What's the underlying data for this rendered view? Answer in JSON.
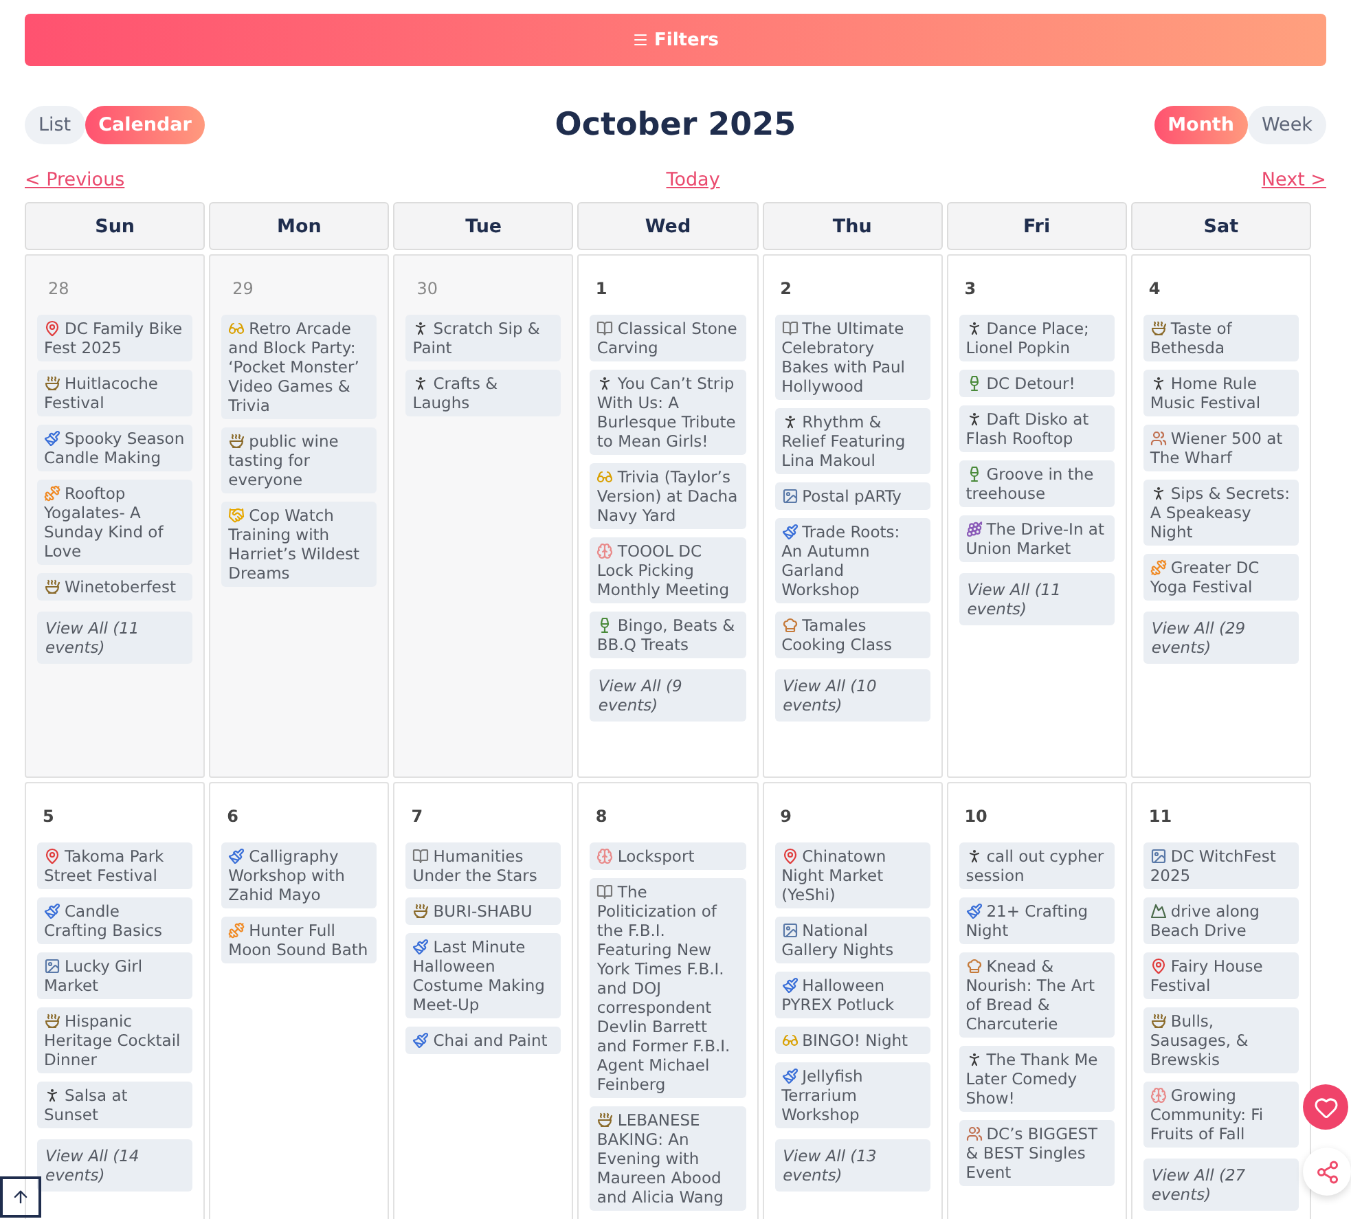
{
  "filters_button": {
    "label": "Filters"
  },
  "view_modes": [
    {
      "label": "List",
      "selected": false
    },
    {
      "label": "Calendar",
      "selected": true
    }
  ],
  "title": "October 2025",
  "range_modes": [
    {
      "label": "Month",
      "selected": true
    },
    {
      "label": "Week",
      "selected": false
    }
  ],
  "nav": {
    "previous": "< Previous",
    "today": "Today",
    "next": "Next >"
  },
  "weekdays": [
    "Sun",
    "Mon",
    "Tue",
    "Wed",
    "Thu",
    "Fri",
    "Sat"
  ],
  "weeks": [
    {
      "days": [
        {
          "number": "28",
          "other_month": true,
          "events": [
            {
              "kind": "pin",
              "title": "DC Family Bike Fest 2025"
            },
            {
              "kind": "bowl",
              "title": "Huitlacoche Festival"
            },
            {
              "kind": "brush",
              "title": "Spooky Season Candle Making"
            },
            {
              "kind": "yoga",
              "title": "Rooftop Yogalates- A Sunday Kind of Love"
            },
            {
              "kind": "bowl",
              "title": "Winetoberfest"
            }
          ],
          "view_all": "View All (11 events)"
        },
        {
          "number": "29",
          "other_month": true,
          "events": [
            {
              "kind": "game",
              "title": "Retro Arcade and Block Party: ‘Pocket Monster’ Video Games & Trivia"
            },
            {
              "kind": "bowl",
              "title": "public wine tasting for everyone"
            },
            {
              "kind": "handshake",
              "title": "Cop Watch Training with Harriet’s Wildest Dreams"
            }
          ]
        },
        {
          "number": "30",
          "other_month": true,
          "events": [
            {
              "kind": "dancer",
              "title": "Scratch Sip & Paint"
            },
            {
              "kind": "dancer",
              "title": "Crafts & Laughs"
            }
          ]
        },
        {
          "number": "1",
          "other_month": false,
          "events": [
            {
              "kind": "book",
              "title": "Classical Stone Carving"
            },
            {
              "kind": "dancer",
              "title": "You Can’t Strip With Us: A Burlesque Tribute to Mean Girls!"
            },
            {
              "kind": "game",
              "title": "Trivia (Taylor’s Version) at Dacha Navy Yard"
            },
            {
              "kind": "brain",
              "title": "TOOOL DC Lock Picking Monthly Meeting"
            },
            {
              "kind": "bottle",
              "title": "Bingo, Beats & BB.Q Treats"
            }
          ],
          "view_all": "View All (9 events)"
        },
        {
          "number": "2",
          "other_month": false,
          "events": [
            {
              "kind": "book",
              "title": "The Ultimate Celebratory Bakes with Paul Hollywood"
            },
            {
              "kind": "dancer",
              "title": "Rhythm & Relief Featuring Lina Makoul"
            },
            {
              "kind": "picture",
              "title": "Postal pARTy"
            },
            {
              "kind": "brush",
              "title": "Trade Roots: An Autumn Garland Workshop"
            },
            {
              "kind": "cook",
              "title": "Tamales Cooking Class"
            }
          ],
          "view_all": "View All (10 events)"
        },
        {
          "number": "3",
          "other_month": false,
          "events": [
            {
              "kind": "dancer",
              "title": "Dance Place; Lionel Popkin"
            },
            {
              "kind": "bottle",
              "title": "DC Detour!"
            },
            {
              "kind": "dancer",
              "title": "Daft Disko at Flash Rooftop"
            },
            {
              "kind": "bottle",
              "title": "Groove in the treehouse"
            },
            {
              "kind": "grapes",
              "title": "The Drive-In at Union Market"
            }
          ],
          "view_all": "View All (11 events)"
        },
        {
          "number": "4",
          "other_month": false,
          "events": [
            {
              "kind": "bowl",
              "title": "Taste of Bethesda"
            },
            {
              "kind": "dancer",
              "title": "Home Rule Music Festival"
            },
            {
              "kind": "couple",
              "title": "Wiener 500 at The Wharf"
            },
            {
              "kind": "dancer",
              "title": "Sips & Secrets: A Speakeasy Night"
            },
            {
              "kind": "yoga",
              "title": "Greater DC Yoga Festival"
            }
          ],
          "view_all": "View All (29 events)"
        }
      ]
    },
    {
      "days": [
        {
          "number": "5",
          "other_month": false,
          "events": [
            {
              "kind": "pin",
              "title": "Takoma Park Street Festival"
            },
            {
              "kind": "brush",
              "title": "Candle Crafting Basics"
            },
            {
              "kind": "picture",
              "title": "Lucky Girl Market"
            },
            {
              "kind": "bowl",
              "title": "Hispanic Heritage Cocktail Dinner"
            },
            {
              "kind": "dancer",
              "title": "Salsa at Sunset"
            }
          ],
          "view_all": "View All (14 events)"
        },
        {
          "number": "6",
          "other_month": false,
          "events": [
            {
              "kind": "brush",
              "title": "Calligraphy Workshop with Zahid Mayo"
            },
            {
              "kind": "yoga",
              "title": "Hunter Full Moon Sound Bath"
            }
          ]
        },
        {
          "number": "7",
          "other_month": false,
          "events": [
            {
              "kind": "book",
              "title": "Humanities Under the Stars"
            },
            {
              "kind": "bowl",
              "title": "BURI-SHABU"
            },
            {
              "kind": "brush",
              "title": "Last Minute Halloween Costume Making Meet-Up"
            },
            {
              "kind": "brush",
              "title": "Chai and Paint"
            }
          ]
        },
        {
          "number": "8",
          "other_month": false,
          "events": [
            {
              "kind": "brain",
              "title": "Locksport"
            },
            {
              "kind": "book",
              "title": "The Politicization of the F.B.I. Featuring New York Times F.B.I. and DOJ correspondent Devlin Barrett and Former F.B.I. Agent Michael Feinberg"
            },
            {
              "kind": "bowl",
              "title": "LEBANESE BAKING: An Evening with Maureen Abood and Alicia Wang"
            }
          ]
        },
        {
          "number": "9",
          "other_month": false,
          "events": [
            {
              "kind": "pin",
              "title": "Chinatown Night Market (YeShi)"
            },
            {
              "kind": "picture",
              "title": "National Gallery Nights"
            },
            {
              "kind": "brush",
              "title": "Halloween PYREX Potluck"
            },
            {
              "kind": "game",
              "title": "BINGO! Night"
            },
            {
              "kind": "brush",
              "title": "Jellyfish Terrarium Workshop"
            }
          ],
          "view_all": "View All (13 events)"
        },
        {
          "number": "10",
          "other_month": false,
          "events": [
            {
              "kind": "dancer",
              "title": "call out cypher session"
            },
            {
              "kind": "brush",
              "title": "21+ Crafting Night"
            },
            {
              "kind": "cook",
              "title": "Knead & Nourish: The Art of Bread & Charcuterie"
            },
            {
              "kind": "dancer",
              "title": "The Thank Me Later Comedy Show!"
            },
            {
              "kind": "couple",
              "title": "DC’s BIGGEST & BEST Singles Event"
            }
          ]
        },
        {
          "number": "11",
          "other_month": false,
          "events": [
            {
              "kind": "picture",
              "title": "DC WitchFest 2025"
            },
            {
              "kind": "landscape",
              "title": "drive along Beach Drive"
            },
            {
              "kind": "pin",
              "title": "Fairy House Festival"
            },
            {
              "kind": "bowl",
              "title": "Bulls, Sausages, & Brewskis"
            },
            {
              "kind": "brain",
              "title": "Growing Community: Fi Fruits of Fall"
            }
          ],
          "view_all": "View All (27 events)"
        }
      ]
    }
  ]
}
